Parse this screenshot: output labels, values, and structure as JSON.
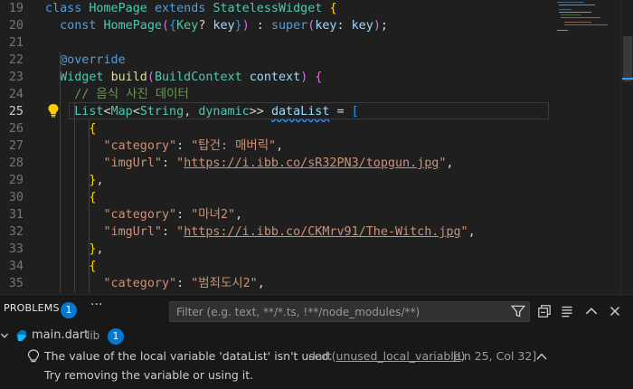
{
  "editor": {
    "lines": [
      {
        "num": "19",
        "tokens": [
          [
            "kw",
            "class "
          ],
          [
            "ty",
            "HomePage "
          ],
          [
            "kw",
            "extends "
          ],
          [
            "ty",
            "StatelessWidget "
          ],
          [
            "b1",
            "{"
          ]
        ]
      },
      {
        "num": "20",
        "tokens": [
          [
            "pu",
            "  "
          ],
          [
            "kw",
            "const "
          ],
          [
            "ty",
            "HomePage"
          ],
          [
            "b2",
            "("
          ],
          [
            "b3",
            "{"
          ],
          [
            "ty",
            "Key"
          ],
          [
            "pu",
            "? "
          ],
          [
            "pm",
            "key"
          ],
          [
            "b3",
            "}"
          ],
          [
            "b2",
            ")"
          ],
          [
            "pu",
            " : "
          ],
          [
            "kw",
            "super"
          ],
          [
            "b2",
            "("
          ],
          [
            "pm",
            "key"
          ],
          [
            "pu",
            ": "
          ],
          [
            "pm",
            "key"
          ],
          [
            "b2",
            ")"
          ],
          [
            "pu",
            ";"
          ]
        ]
      },
      {
        "num": "21",
        "tokens": []
      },
      {
        "num": "22",
        "tokens": [
          [
            "pu",
            "  "
          ],
          [
            "kw",
            "@override"
          ]
        ]
      },
      {
        "num": "23",
        "tokens": [
          [
            "pu",
            "  "
          ],
          [
            "ty",
            "Widget "
          ],
          [
            "fn",
            "build"
          ],
          [
            "b2",
            "("
          ],
          [
            "ty",
            "BuildContext "
          ],
          [
            "pm",
            "context"
          ],
          [
            "b2",
            ")"
          ],
          [
            "pu",
            " "
          ],
          [
            "b2",
            "{"
          ]
        ]
      },
      {
        "num": "24",
        "tokens": [
          [
            "pu",
            "    "
          ],
          [
            "cm",
            "// 음식 사진 데이터"
          ]
        ]
      },
      {
        "num": "25",
        "tokens": [
          [
            "pu",
            "    "
          ],
          [
            "ty",
            "List"
          ],
          [
            "pu",
            "<"
          ],
          [
            "ty",
            "Map"
          ],
          [
            "pu",
            "<"
          ],
          [
            "ty",
            "String"
          ],
          [
            "pu",
            ", "
          ],
          [
            "ty",
            "dynamic"
          ],
          [
            "pu",
            ">> "
          ],
          [
            "pm squig",
            "dataList"
          ],
          [
            "pu",
            " = "
          ],
          [
            "b3",
            "["
          ]
        ]
      },
      {
        "num": "26",
        "tokens": [
          [
            "pu",
            "      "
          ],
          [
            "b1",
            "{"
          ]
        ]
      },
      {
        "num": "27",
        "tokens": [
          [
            "pu",
            "        "
          ],
          [
            "st",
            "\"category\""
          ],
          [
            "pu",
            ": "
          ],
          [
            "st",
            "\"탑건: 매버릭\""
          ],
          [
            "pu",
            ","
          ]
        ]
      },
      {
        "num": "28",
        "tokens": [
          [
            "pu",
            "        "
          ],
          [
            "st",
            "\"imgUrl\""
          ],
          [
            "pu",
            ": "
          ],
          [
            "st",
            "\""
          ],
          [
            "st ul",
            "https://i.ibb.co/sR32PN3/topgun.jpg"
          ],
          [
            "st",
            "\""
          ],
          [
            "pu",
            ","
          ]
        ]
      },
      {
        "num": "29",
        "tokens": [
          [
            "pu",
            "      "
          ],
          [
            "b1",
            "}"
          ],
          [
            "pu",
            ","
          ]
        ]
      },
      {
        "num": "30",
        "tokens": [
          [
            "pu",
            "      "
          ],
          [
            "b1",
            "{"
          ]
        ]
      },
      {
        "num": "31",
        "tokens": [
          [
            "pu",
            "        "
          ],
          [
            "st",
            "\"category\""
          ],
          [
            "pu",
            ": "
          ],
          [
            "st",
            "\"마녀2\""
          ],
          [
            "pu",
            ","
          ]
        ]
      },
      {
        "num": "32",
        "tokens": [
          [
            "pu",
            "        "
          ],
          [
            "st",
            "\"imgUrl\""
          ],
          [
            "pu",
            ": "
          ],
          [
            "st",
            "\""
          ],
          [
            "st ul",
            "https://i.ibb.co/CKMrv91/The-Witch.jpg"
          ],
          [
            "st",
            "\""
          ],
          [
            "pu",
            ","
          ]
        ]
      },
      {
        "num": "33",
        "tokens": [
          [
            "pu",
            "      "
          ],
          [
            "b1",
            "}"
          ],
          [
            "pu",
            ","
          ]
        ]
      },
      {
        "num": "34",
        "tokens": [
          [
            "pu",
            "      "
          ],
          [
            "b1",
            "{"
          ]
        ]
      },
      {
        "num": "35",
        "tokens": [
          [
            "pu",
            "        "
          ],
          [
            "st",
            "\"category\""
          ],
          [
            "pu",
            ": "
          ],
          [
            "st",
            "\"범죄도시2\""
          ],
          [
            "pu",
            ","
          ]
        ]
      }
    ],
    "active_line": "25"
  },
  "panel": {
    "tab_label": "PROBLEMS",
    "tab_count": "1",
    "more_label": "···",
    "filter_placeholder": "Filter (e.g. text, **/*.ts, !**/node_modules/**)",
    "file": {
      "name": "main.dart",
      "folder": "lib",
      "count": "1"
    },
    "problem": {
      "message": "The value of the local variable 'dataList' isn't used.",
      "source_prefix": "dart(",
      "source_code": "unused_local_variable",
      "source_suffix": ")",
      "location": "[Ln 25, Col 32]",
      "hint": "Try removing the variable or using it."
    }
  },
  "colors": {
    "accent": "#0078d4",
    "lightbulb": "#ffcc00",
    "background": "#1f1f1f",
    "panel": "#181818"
  }
}
